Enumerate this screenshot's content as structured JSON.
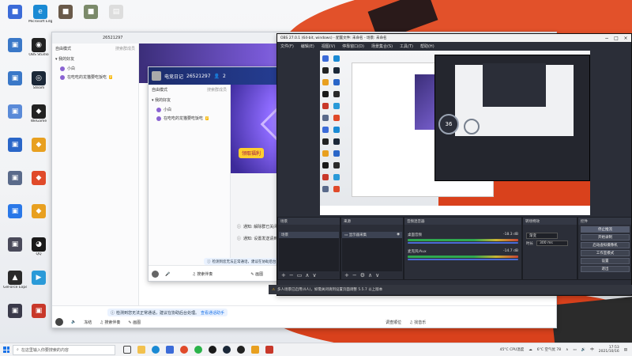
{
  "desktop": {
    "icons": [
      {
        "label": "",
        "color": "#3b6bd8",
        "glyph": "■"
      },
      {
        "label": "Microsoft Edge",
        "color": "#1a8ad4",
        "glyph": "e"
      },
      {
        "label": "",
        "color": "#6a5a4a",
        "glyph": "■"
      },
      {
        "label": "",
        "color": "#7b8a6a",
        "glyph": "■"
      },
      {
        "label": "",
        "color": "#dddddd",
        "glyph": "▤"
      },
      {
        "label": "",
        "color": "#3a78c8",
        "glyph": "▣"
      },
      {
        "label": "OBS Studio",
        "color": "#222222",
        "glyph": "◉"
      },
      {
        "label": "",
        "color": "#3a78c8",
        "glyph": "▣"
      },
      {
        "label": "Steam",
        "color": "#1b2838",
        "glyph": "◎"
      },
      {
        "label": "",
        "color": "#5a8ad8",
        "glyph": "▣"
      },
      {
        "label": "WeGame",
        "color": "#222222",
        "glyph": "◆"
      },
      {
        "label": "",
        "color": "#2a66c8",
        "glyph": "▣"
      },
      {
        "label": "",
        "color": "#e8a020",
        "glyph": "◆"
      },
      {
        "label": "",
        "color": "#5a6a8a",
        "glyph": "▣"
      },
      {
        "label": "",
        "color": "#e04a2a",
        "glyph": "◆"
      },
      {
        "label": "",
        "color": "#2a78e8",
        "glyph": "▣"
      },
      {
        "label": "",
        "color": "#e8a020",
        "glyph": "◆"
      },
      {
        "label": "",
        "color": "#4a4a5a",
        "glyph": "▣"
      },
      {
        "label": "QQ",
        "color": "#1a1a1a",
        "glyph": "◕"
      },
      {
        "label": "GeForce Experience",
        "color": "#2a2a2a",
        "glyph": "▲"
      },
      {
        "label": "",
        "color": "#2a9ad8",
        "glyph": "▶"
      },
      {
        "label": "",
        "color": "#3a3a4a",
        "glyph": "▣"
      },
      {
        "label": "",
        "color": "#c8382a",
        "glyph": "▣"
      }
    ]
  },
  "qq_main": {
    "title_id": "26521297",
    "group_header": "自由模式",
    "search_hint": "搜索群成员",
    "group_name": "我的好友",
    "members": [
      {
        "name": "小白",
        "badge": ""
      },
      {
        "name": "在吃吃的龙猫要吃饭吃",
        "badge": "P"
      }
    ],
    "notice": "检测到您无法正常通话，建议在协助后台处理。",
    "notice_link": "查看通话助手",
    "tools": [
      "♫",
      "冻结",
      "♫ 搜索伴奏",
      "✎ 画图"
    ],
    "right_tools": [
      "调查顺位",
      "♫ 找音乐"
    ]
  },
  "qq_chat": {
    "title": "电竞日记",
    "id": "26521297",
    "count": "2",
    "group_header": "自由模式",
    "search_hint": "搜索群成员",
    "group_name": "我的好友",
    "members": [
      {
        "name": "小白",
        "badge": ""
      },
      {
        "name": "在吃吃的龙猫要吃饭吃",
        "badge": "P"
      }
    ],
    "banner_tag": "领取福利",
    "messages": [
      "通知: 解除群已关闭",
      "通知: 设置发送请到群"
    ],
    "notice": "检测到您无法正常通话，建议在协助后台...",
    "tools": [
      "♫ 搜索伴奏",
      "✎ 画图"
    ]
  },
  "obs": {
    "title": "OBS 27.0.1 (64-bit, windows) - 配置文件: 未命名 - 场景: 未命名",
    "menu": [
      "文件(F)",
      "编辑(E)",
      "视图(V)",
      "停靠窗口(D)",
      "场景集合(S)",
      "工具(T)",
      "帮助(H)"
    ],
    "preview_circle": "36",
    "scene_tabs": [
      "场景",
      "来源",
      "音频混音器",
      "转场特效",
      "控件"
    ],
    "scenes": [
      "场景"
    ],
    "sources": [
      "显示器采集"
    ],
    "mixer": [
      {
        "name": "桌面音频",
        "level": "-18.3 dB"
      },
      {
        "name": "麦克风/Aux",
        "level": "-14.7 dB"
      }
    ],
    "transition": {
      "type": "渐变",
      "duration_label": "时长",
      "duration": "300 ms"
    },
    "controls": [
      "停止推流",
      "开始录制",
      "启动虚拟摄像机",
      "工作室模式",
      "设置",
      "退出"
    ],
    "status": [
      "LIVE: 00:00:00",
      "REC: 00:00:00",
      "CPU: 6.9%, 60.00 fps"
    ],
    "notice": "多人场景已启用(4人)，如需关闭请到设置页面调整 5.5.7 以上版本"
  },
  "taskbar": {
    "search_placeholder": "在这里输入你要搜索的内容",
    "weather": "6°C 空气优 78",
    "cpu": "45°C CPU温度",
    "time": "17:53",
    "date": "2021/10/16"
  },
  "colors": {
    "accent": "#1a73e8",
    "obs_bg": "#2b2e38",
    "wallpaper_red": "#e0481f"
  }
}
